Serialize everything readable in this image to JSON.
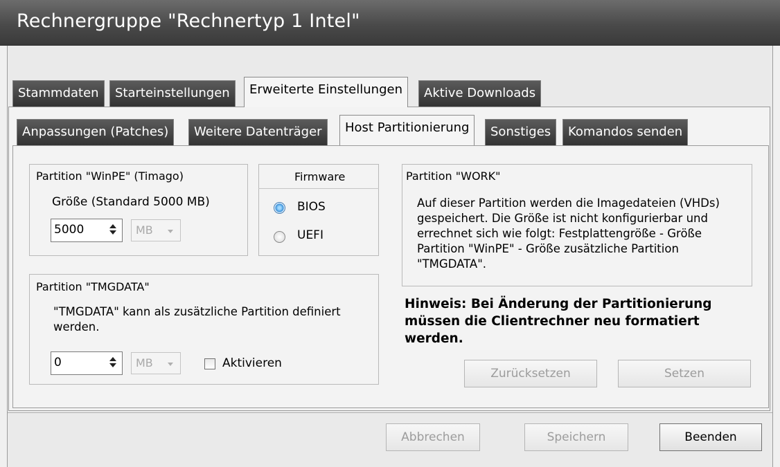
{
  "window": {
    "title": "Rechnergruppe \"Rechnertyp 1 Intel\""
  },
  "tabs_main": [
    {
      "label": "Stammdaten"
    },
    {
      "label": "Starteinstellungen"
    },
    {
      "label": "Erweiterte Einstellungen",
      "active": true
    },
    {
      "label": "Aktive Downloads"
    }
  ],
  "tabs_sub": [
    {
      "label": "Anpassungen (Patches)"
    },
    {
      "label": "Weitere Datenträger"
    },
    {
      "label": "Host Partitionierung",
      "active": true
    },
    {
      "label": "Sonstiges"
    },
    {
      "label": "Komandos senden"
    }
  ],
  "winpe": {
    "title": "Partition \"WinPE\" (Timago)",
    "size_label": "Größe (Standard 5000 MB)",
    "size_value": "5000",
    "unit": "MB"
  },
  "firmware": {
    "title": "Firmware",
    "options": [
      {
        "label": "BIOS",
        "selected": true
      },
      {
        "label": "UEFI",
        "selected": false
      }
    ]
  },
  "tmgdata": {
    "title": "Partition \"TMGDATA\"",
    "description": "\"TMGDATA\" kann als zusätzliche Partition definiert werden.",
    "size_value": "0",
    "unit": "MB",
    "activate_label": "Aktivieren",
    "activate_checked": false
  },
  "work": {
    "title": "Partition \"WORK\"",
    "description": "Auf dieser Partition werden die Imagedateien (VHDs) gespeichert. Die Größe ist nicht konfigurierbar und errechnet sich wie folgt: Festplattengröße - Größe Partition \"WinPE\" - Größe zusätzliche Partition \"TMGDATA\"."
  },
  "hint": "Hinweis: Bei Änderung der Partitionierung müssen die Clientrechner neu formatiert werden.",
  "buttons": {
    "reset": "Zurücksetzen",
    "set": "Setzen",
    "cancel": "Abbrechen",
    "save": "Speichern",
    "close": "Beenden"
  }
}
